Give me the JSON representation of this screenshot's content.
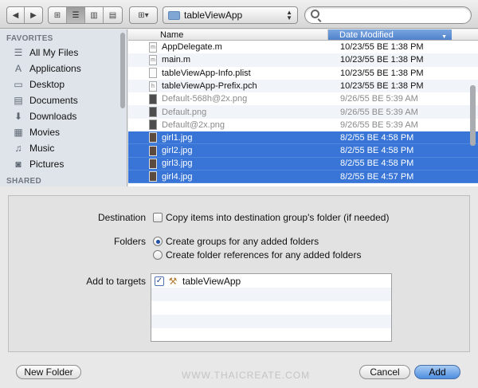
{
  "toolbar": {
    "back_icon": "◀",
    "forward_icon": "▶",
    "view_icons": [
      "⊞",
      "☰",
      "▥",
      "▤"
    ],
    "arrange_icon": "⊞▾",
    "path_folder": "tableViewApp",
    "search_placeholder": ""
  },
  "sidebar": {
    "heading_favorites": "FAVORITES",
    "heading_shared": "SHARED",
    "items": [
      {
        "label": "All My Files",
        "icon": "☰"
      },
      {
        "label": "Applications",
        "icon": "A"
      },
      {
        "label": "Desktop",
        "icon": "▭"
      },
      {
        "label": "Documents",
        "icon": "▤"
      },
      {
        "label": "Downloads",
        "icon": "⬇"
      },
      {
        "label": "Movies",
        "icon": "▦"
      },
      {
        "label": "Music",
        "icon": "♫"
      },
      {
        "label": "Pictures",
        "icon": "◙"
      }
    ]
  },
  "files": {
    "col_name": "Name",
    "col_date": "Date Modified",
    "sort_icon": "▼",
    "rows": [
      {
        "name": "AppDelegate.m",
        "date": "10/23/55 BE 1:38 PM",
        "icon": "m",
        "kind": "src",
        "state": "normal"
      },
      {
        "name": "main.m",
        "date": "10/23/55 BE 1:38 PM",
        "icon": "m",
        "kind": "src",
        "state": "normal"
      },
      {
        "name": "tableViewApp-Info.plist",
        "date": "10/23/55 BE 1:38 PM",
        "icon": "",
        "kind": "src",
        "state": "normal"
      },
      {
        "name": "tableViewApp-Prefix.pch",
        "date": "10/23/55 BE 1:38 PM",
        "icon": "h",
        "kind": "src",
        "state": "normal"
      },
      {
        "name": "Default-568h@2x.png",
        "date": "9/26/55 BE 5:39 AM",
        "icon": "",
        "kind": "png",
        "state": "dim"
      },
      {
        "name": "Default.png",
        "date": "9/26/55 BE 5:39 AM",
        "icon": "",
        "kind": "png",
        "state": "dim"
      },
      {
        "name": "Default@2x.png",
        "date": "9/26/55 BE 5:39 AM",
        "icon": "",
        "kind": "png",
        "state": "dim"
      },
      {
        "name": "girl1.jpg",
        "date": "8/2/55 BE 4:58 PM",
        "icon": "",
        "kind": "img",
        "state": "sel"
      },
      {
        "name": "girl2.jpg",
        "date": "8/2/55 BE 4:58 PM",
        "icon": "",
        "kind": "img",
        "state": "sel"
      },
      {
        "name": "girl3.jpg",
        "date": "8/2/55 BE 4:58 PM",
        "icon": "",
        "kind": "img",
        "state": "sel"
      },
      {
        "name": "girl4.jpg",
        "date": "8/2/55 BE 4:57 PM",
        "icon": "",
        "kind": "img",
        "state": "sel"
      }
    ]
  },
  "options": {
    "destination_label": "Destination",
    "destination_option": "Copy items into destination group's folder (if needed)",
    "destination_checked": false,
    "folders_label": "Folders",
    "folder_option_groups": "Create groups for any added folders",
    "folder_option_refs": "Create folder references for any added folders",
    "folders_selected": "groups",
    "targets_label": "Add to targets",
    "targets": [
      {
        "name": "tableViewApp",
        "checked": true,
        "check_icon": "✓",
        "icon": "⚒"
      }
    ]
  },
  "buttons": {
    "new_folder": "New Folder",
    "cancel": "Cancel",
    "add": "Add"
  },
  "watermark": "WWW.THAICREATE.COM"
}
